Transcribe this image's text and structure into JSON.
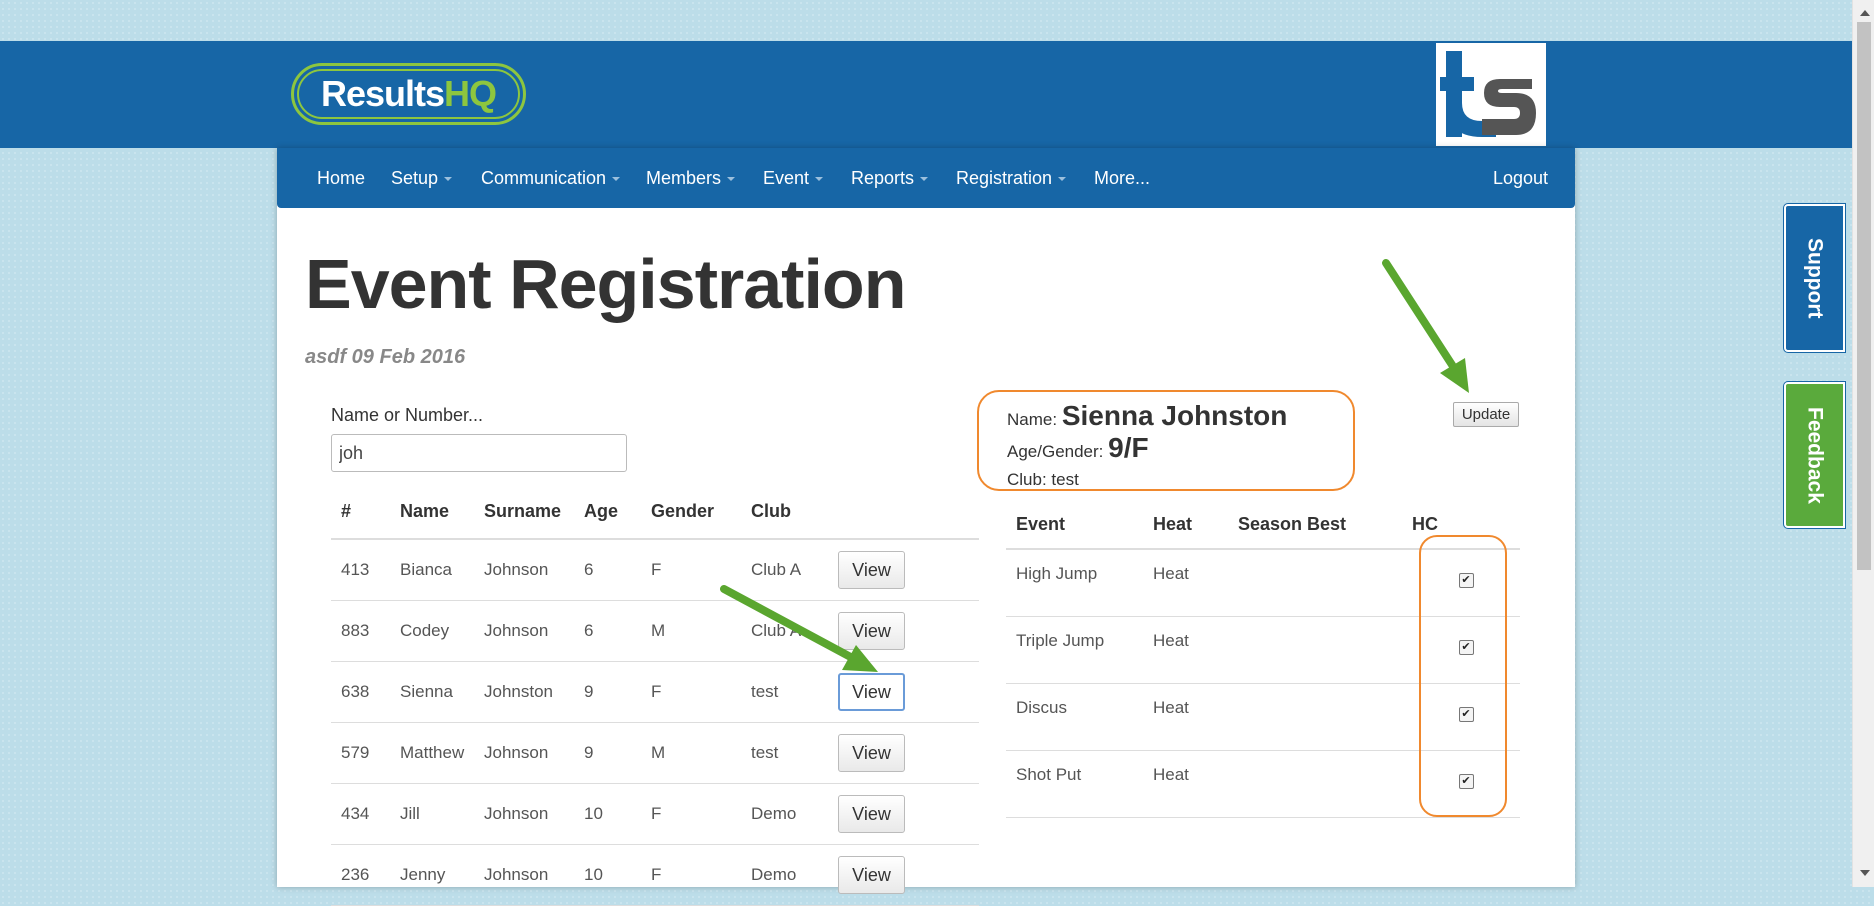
{
  "header": {
    "logo_text_main": "Results",
    "logo_text_accent": "HQ",
    "ts_logo_name": "ts"
  },
  "nav": {
    "items": [
      {
        "label": "Home",
        "has_caret": false
      },
      {
        "label": "Setup",
        "has_caret": true
      },
      {
        "label": "Communication",
        "has_caret": true
      },
      {
        "label": "Members",
        "has_caret": true
      },
      {
        "label": "Event",
        "has_caret": true
      },
      {
        "label": "Reports",
        "has_caret": true
      },
      {
        "label": "Registration",
        "has_caret": true
      },
      {
        "label": "More...",
        "has_caret": false
      }
    ],
    "logout": "Logout"
  },
  "page": {
    "title": "Event Registration",
    "subtitle": "asdf 09 Feb 2016"
  },
  "search": {
    "label": "Name or Number...",
    "value": "joh"
  },
  "members_table": {
    "headers": [
      "#",
      "Name",
      "Surname",
      "Age",
      "Gender",
      "Club"
    ],
    "view_label": "View",
    "rows": [
      {
        "num": "413",
        "name": "Bianca",
        "surname": "Johnson",
        "age": "6",
        "gender": "F",
        "club": "Club A"
      },
      {
        "num": "883",
        "name": "Codey",
        "surname": "Johnson",
        "age": "6",
        "gender": "M",
        "club": "Club A"
      },
      {
        "num": "638",
        "name": "Sienna",
        "surname": "Johnston",
        "age": "9",
        "gender": "F",
        "club": "test"
      },
      {
        "num": "579",
        "name": "Matthew",
        "surname": "Johnson",
        "age": "9",
        "gender": "M",
        "club": "test"
      },
      {
        "num": "434",
        "name": "Jill",
        "surname": "Johnson",
        "age": "10",
        "gender": "F",
        "club": "Demo"
      },
      {
        "num": "236",
        "name": "Jenny",
        "surname": "Johnson",
        "age": "10",
        "gender": "F",
        "club": "Demo"
      }
    ],
    "active_row": 2
  },
  "details": {
    "name_label": "Name:",
    "name_value": "Sienna Johnston",
    "age_gender_label": "Age/Gender:",
    "age_gender_value": "9/F",
    "club_label": "Club:",
    "club_value": "test"
  },
  "update_label": "Update",
  "events_table": {
    "headers": [
      "Event",
      "Heat",
      "Season Best",
      "HC"
    ],
    "rows": [
      {
        "event": "High Jump",
        "heat": "Heat",
        "season_best": "",
        "hc": true
      },
      {
        "event": "Triple Jump",
        "heat": "Heat",
        "season_best": "",
        "hc": true
      },
      {
        "event": "Discus",
        "heat": "Heat",
        "season_best": "",
        "hc": true
      },
      {
        "event": "Shot Put",
        "heat": "Heat",
        "season_best": "",
        "hc": true
      }
    ]
  },
  "side_tabs": {
    "support": "Support",
    "feedback": "Feedback"
  },
  "colors": {
    "brand_blue": "#1766a6",
    "accent_green": "#8dc63f",
    "highlight_orange": "#f0892e",
    "arrow_green": "#5aa62f"
  }
}
